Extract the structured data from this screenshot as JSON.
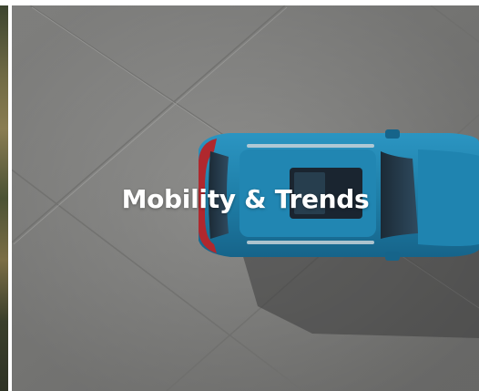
{
  "tile": {
    "title": "Mobility & Trends",
    "image_subject": "aerial-car-on-concrete"
  },
  "colors": {
    "concrete": "#8f8f8d",
    "car_body": "#1f7fa8",
    "title_text": "#ffffff"
  }
}
